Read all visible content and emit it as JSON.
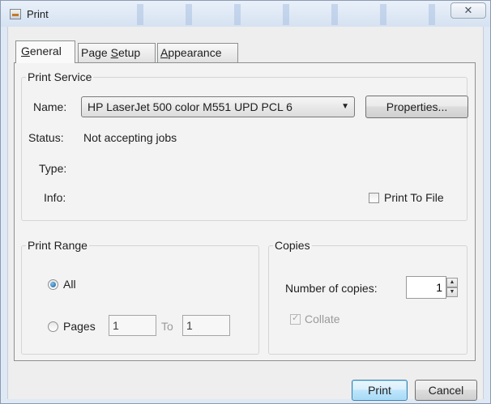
{
  "window": {
    "title": "Print",
    "close_glyph": "✕"
  },
  "tabs": [
    {
      "label_pre": "",
      "label_key": "G",
      "label_post": "eneral",
      "active": true
    },
    {
      "label_pre": "Page ",
      "label_key": "S",
      "label_post": "etup",
      "active": false
    },
    {
      "label_pre": "",
      "label_key": "A",
      "label_post": "ppearance",
      "active": false
    }
  ],
  "print_service": {
    "legend": "Print Service",
    "name_label": "Name:",
    "name_value": "HP LaserJet 500 color M551 UPD PCL 6",
    "dropdown_glyph": "▼",
    "properties_button": "Properties...",
    "status_label": "Status:",
    "status_value": "Not accepting jobs",
    "type_label": "Type:",
    "info_label": "Info:",
    "print_to_file_label": "Print To File",
    "print_to_file_checked": false
  },
  "print_range": {
    "legend": "Print Range",
    "all_label": "All",
    "all_selected": true,
    "pages_label": "Pages",
    "pages_from": "1",
    "to_label": "To",
    "pages_to": "1"
  },
  "copies": {
    "legend": "Copies",
    "number_label": "Number of copies:",
    "number_value": "1",
    "spin_up_glyph": "▲",
    "spin_down_glyph": "▼",
    "collate_label": "Collate",
    "collate_checked": true,
    "collate_glyph": "✓",
    "collate_enabled": false
  },
  "footer": {
    "print_button": "Print",
    "cancel_button": "Cancel"
  }
}
